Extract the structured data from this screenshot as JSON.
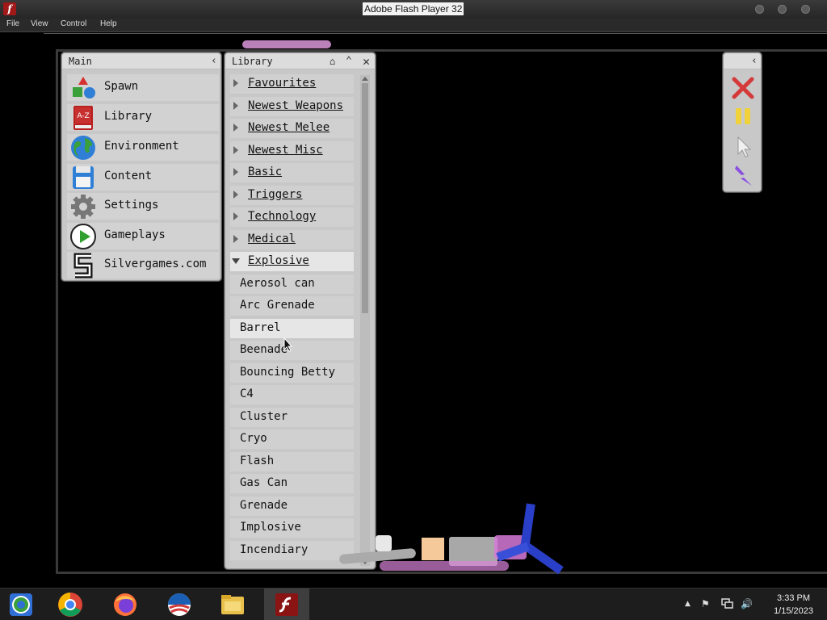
{
  "window": {
    "title": "Adobe Flash Player 32"
  },
  "menu": [
    "File",
    "View",
    "Control",
    "Help"
  ],
  "main_panel": {
    "title": "Main",
    "items": [
      {
        "label": "Spawn",
        "icon": "shapes-icon"
      },
      {
        "label": "Library",
        "icon": "library-book-icon",
        "badge": "A-Z"
      },
      {
        "label": "Environment",
        "icon": "globe-icon"
      },
      {
        "label": "Content",
        "icon": "floppy-disk-icon"
      },
      {
        "label": "Settings",
        "icon": "gear-icon"
      },
      {
        "label": "Gameplays",
        "icon": "play-icon"
      },
      {
        "label": "Silvergames.com",
        "icon": "silvergames-logo-icon"
      }
    ]
  },
  "library_panel": {
    "title": "Library",
    "categories": [
      {
        "label": "Favourites",
        "expanded": false
      },
      {
        "label": "Newest Weapons",
        "expanded": false
      },
      {
        "label": "Newest Melee",
        "expanded": false
      },
      {
        "label": "Newest Misc",
        "expanded": false
      },
      {
        "label": "Basic",
        "expanded": false
      },
      {
        "label": "Triggers",
        "expanded": false
      },
      {
        "label": "Technology",
        "expanded": false
      },
      {
        "label": "Medical",
        "expanded": false
      },
      {
        "label": "Explosive",
        "expanded": true
      }
    ],
    "items": [
      "Aerosol can",
      "Arc Grenade",
      "Barrel",
      "Beenade",
      "Bouncing Betty",
      "C4",
      "Cluster",
      "Cryo",
      "Flash",
      "Gas Can",
      "Grenade",
      "Implosive",
      "Incendiary"
    ],
    "hovered_item": "Barrel"
  },
  "tools_panel": {
    "tools": [
      {
        "name": "close-x-icon",
        "color": "#d43a3a"
      },
      {
        "name": "pause-icon",
        "color": "#f2d23a"
      },
      {
        "name": "pointer-icon",
        "color": "#f0f0f0"
      },
      {
        "name": "lightning-icon",
        "color": "#8a4fe0"
      }
    ]
  },
  "taskbar": {
    "apps": [
      "chromium-icon",
      "chrome-icon",
      "firefox-icon",
      "obama-logo-icon",
      "file-explorer-icon",
      "flash-player-icon"
    ],
    "time": "3:33 PM",
    "date": "1/15/2023"
  }
}
